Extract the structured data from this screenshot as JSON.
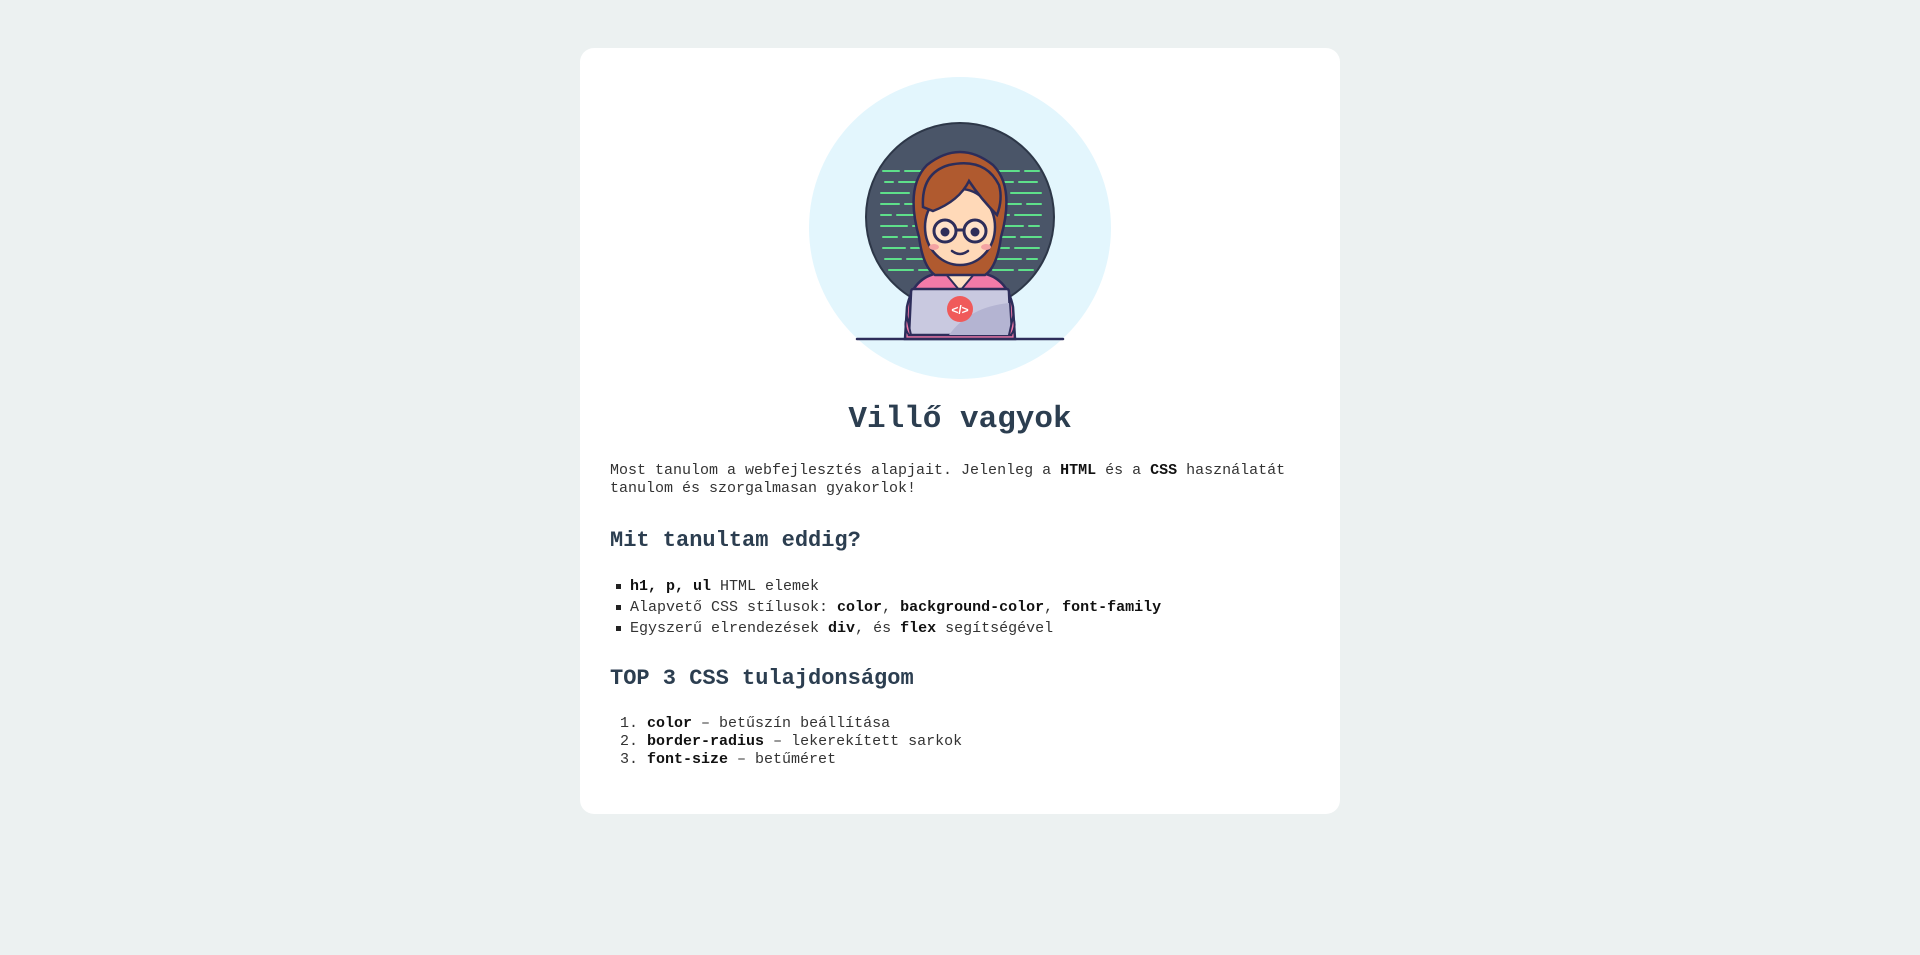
{
  "profile": {
    "title": "Villő vagyok",
    "avatar_icon": "girl-coding-on-laptop-icon",
    "laptop_badge": "</>"
  },
  "intro": {
    "t1": "Most tanulom a webfejlesztés alapjait. Jelenleg a ",
    "b1": "HTML",
    "t2": " és a ",
    "b2": "CSS",
    "t3": " használatát tanulom és szorgalmasan gyakorlok!"
  },
  "learned": {
    "heading": "Mit tanultam eddig?",
    "items": [
      {
        "b1": "h1, p, ul",
        "t1": " HTML elemek"
      },
      {
        "t1": "Alapvető CSS stílusok: ",
        "b1": "color",
        "t2": ", ",
        "b2": "background-color",
        "t3": ", ",
        "b3": "font-family"
      },
      {
        "t1": "Egyszerű elrendezések ",
        "b1": "div",
        "t2": ", és ",
        "b2": "flex",
        "t3": " segítségével"
      }
    ]
  },
  "top": {
    "heading": "TOP 3 CSS tulajdonságom",
    "items": [
      {
        "num": "1.",
        "b": "color",
        "t": " – betűszín beállítása"
      },
      {
        "num": "2.",
        "b": "border-radius",
        "t": " – lekerekített sarkok"
      },
      {
        "num": "3.",
        "b": "font-size",
        "t": " – betűméret"
      }
    ]
  },
  "colors": {
    "page_bg": "#ecf1f1",
    "card_bg": "#ffffff",
    "heading": "#2c3e50",
    "avatar_bg": "#e3f6fd",
    "avatar_inner": "#4a5568",
    "code_lines": "#5ee08a"
  }
}
